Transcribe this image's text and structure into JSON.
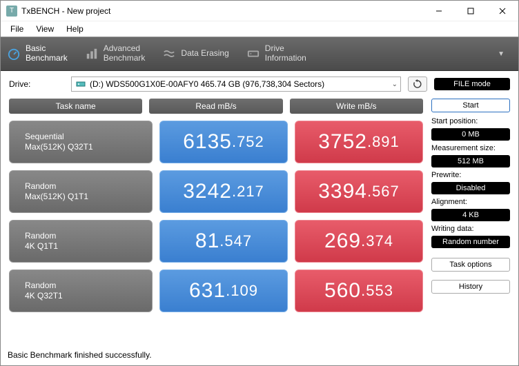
{
  "window": {
    "title": "TxBENCH - New project"
  },
  "menu": {
    "file": "File",
    "view": "View",
    "help": "Help"
  },
  "toolbar": {
    "basic": {
      "line1": "Basic",
      "line2": "Benchmark"
    },
    "advanced": {
      "line1": "Advanced",
      "line2": "Benchmark"
    },
    "erasing": "Data Erasing",
    "drive": {
      "line1": "Drive",
      "line2": "Information"
    }
  },
  "drive": {
    "label": "Drive:",
    "selected": "(D:) WDS500G1X0E-00AFY0  465.74 GB (976,738,304 Sectors)"
  },
  "file_mode": "FILE mode",
  "headers": {
    "task": "Task name",
    "read": "Read mB/s",
    "write": "Write mB/s"
  },
  "rows": [
    {
      "name1": "Sequential",
      "name2": "Max(512K) Q32T1",
      "read_int": "6135",
      "read_dec": ".752",
      "write_int": "3752",
      "write_dec": ".891"
    },
    {
      "name1": "Random",
      "name2": "Max(512K) Q1T1",
      "read_int": "3242",
      "read_dec": ".217",
      "write_int": "3394",
      "write_dec": ".567"
    },
    {
      "name1": "Random",
      "name2": "4K Q1T1",
      "read_int": "81",
      "read_dec": ".547",
      "write_int": "269",
      "write_dec": ".374"
    },
    {
      "name1": "Random",
      "name2": "4K Q32T1",
      "read_int": "631",
      "read_dec": ".109",
      "write_int": "560",
      "write_dec": ".553"
    }
  ],
  "sidebar": {
    "start": "Start",
    "start_pos_label": "Start position:",
    "start_pos_value": "0 MB",
    "meas_label": "Measurement size:",
    "meas_value": "512 MB",
    "prewrite_label": "Prewrite:",
    "prewrite_value": "Disabled",
    "align_label": "Alignment:",
    "align_value": "4 KB",
    "writing_label": "Writing data:",
    "writing_value": "Random number",
    "task_options": "Task options",
    "history": "History"
  },
  "status": "Basic Benchmark finished successfully."
}
